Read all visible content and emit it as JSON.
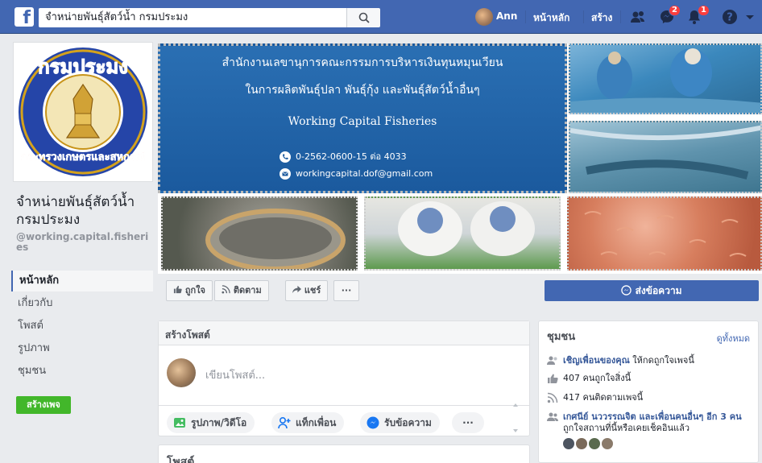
{
  "topbar": {
    "logo": "f",
    "search_value": "จำหน่ายพันธุ์สัตว์น้ำ กรมประมง",
    "user_name": "Ann",
    "nav_home": "หน้าหลัก",
    "nav_create": "สร้าง",
    "badge_messages": "2",
    "badge_notifications": "1"
  },
  "page": {
    "name": "จำหน่ายพันธุ์สัตว์น้ำ กรมประมง",
    "handle": "@working.capital.fisheries"
  },
  "left_menu": [
    {
      "label": "หน้าหลัก",
      "active": true
    },
    {
      "label": "เกี่ยวกับ",
      "active": false
    },
    {
      "label": "โพสต์",
      "active": false
    },
    {
      "label": "รูปภาพ",
      "active": false
    },
    {
      "label": "ชุมชน",
      "active": false
    }
  ],
  "create_page_button": "สร้างเพจ",
  "cover": {
    "line1": "สำนักงานเลขานุการคณะกรรมการบริหารเงินทุนหมุนเวียน",
    "line2": "ในการผลิตพันธุ์ปลา พันธุ์กุ้ง และพันธุ์สัตว์น้ำอื่นๆ",
    "line3": "Working Capital Fisheries",
    "phone": "0-2562-0600-15 ต่อ 4033",
    "email": "workingcapital.dof@gmail.com"
  },
  "actions": {
    "like": "ถูกใจ",
    "follow": "ติดตาม",
    "share": "แชร์",
    "more": "···",
    "send_message": "ส่งข้อความ"
  },
  "composer": {
    "header": "สร้างโพสต์",
    "placeholder": "เขียนโพสต์...",
    "photo_video": "รูปภาพ/วิดีโอ",
    "tag_friends": "แท็กเพื่อน",
    "get_messages": "รับข้อความ",
    "more": "···"
  },
  "posts_header": "โพสต์",
  "community": {
    "title": "ชุมชน",
    "see_all": "ดูทั้งหมด",
    "invite_link": "เชิญเพื่อนของคุณ",
    "invite_rest": "ให้กดถูกใจเพจนี้",
    "likes": "407 คนถูกใจสิ่งนี้",
    "followers": "417 คนติดตามเพจนี้",
    "friends_link": "เกศนีย์ นววรรณจิต และเพื่อนคนอื่นๆ อีก 3 คน",
    "friends_rest": "ถูกใจสถานที่นี้หรือเคยเช็คอินแล้ว"
  },
  "colors": {
    "brand": "#4267b2",
    "green": "#42b72a",
    "badge": "#fa3e3e"
  }
}
